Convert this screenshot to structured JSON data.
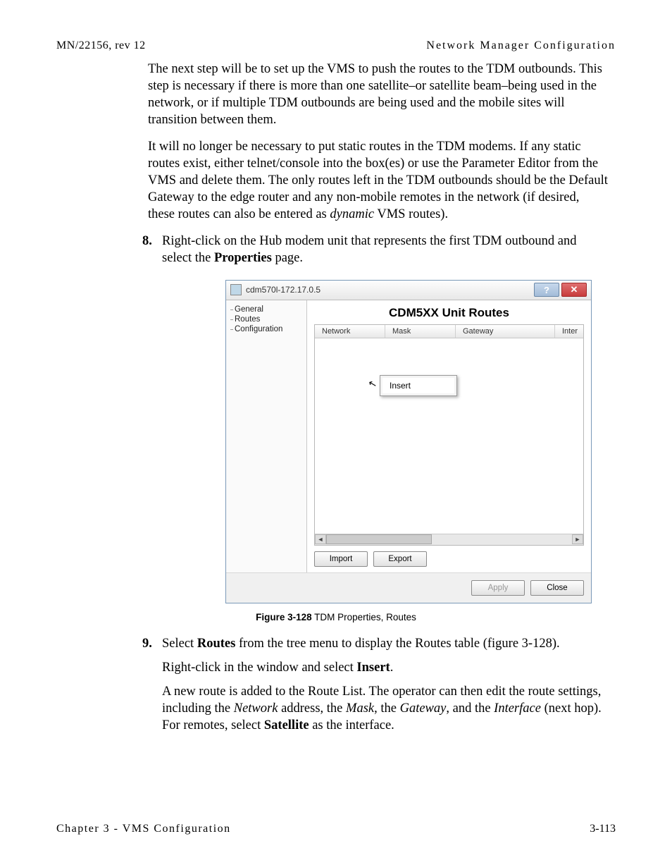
{
  "meta": {
    "doc_id": "MN/22156, rev 12",
    "section_title": "Network Manager Configuration",
    "chapter_footer": "Chapter 3 - VMS Configuration",
    "page_number": "3-113"
  },
  "paragraphs": {
    "p1": "The next step will be to set up the VMS to push the routes to the TDM outbounds. This step is necessary if there is more than one satellite–or satellite beam–being used in the network, or if multiple TDM outbounds are being used and the mobile sites will transition between them.",
    "p2a": "It will no longer be necessary to put static routes in the TDM modems. If any static routes exist, either telnet/console into the box(es) or use the Parameter Editor from the VMS and delete them. The only routes left in the TDM outbounds should be the Default Gateway to the edge router and any non-mobile remotes in the network (if desired, these routes can also be entered as ",
    "p2_dyn": "dynamic",
    "p2b": " VMS routes).",
    "step8_num": " 8.",
    "step8_a": "Right-click on the Hub modem unit that represents the first TDM outbound and select the ",
    "step8_bold": "Properties",
    "step8_b": " page.",
    "step9_num": " 9.",
    "step9_a": "Select ",
    "step9_bold1": "Routes",
    "step9_b": " from the tree menu to display the Routes table (figure 3-128).",
    "step9_p2a": "Right-click in the window and select ",
    "step9_p2_bold": "Insert",
    "step9_p2b": ".",
    "step9_p3a": "A new route is added to the Route List. The operator can then edit the route settings, including the ",
    "step9_p3_net": "Network",
    "step9_p3b": " address, the ",
    "step9_p3_mask": "Mask",
    "step9_p3c": ", the ",
    "step9_p3_gw": "Gateway",
    "step9_p3d": ", and the ",
    "step9_p3_if": "Interface",
    "step9_p3e": " (next hop). For remotes, select ",
    "step9_p3_sat": "Satellite",
    "step9_p3f": " as the interface."
  },
  "dialog": {
    "title": "cdm570l-172.17.0.5",
    "tree": {
      "n1": "General",
      "n2": "Routes",
      "n3": "Configuration"
    },
    "panel_title": "CDM5XX Unit Routes",
    "columns": {
      "network": "Network",
      "mask": "Mask",
      "gateway": "Gateway",
      "inter": "Inter"
    },
    "context_menu": {
      "insert": "Insert"
    },
    "buttons": {
      "import": "Import",
      "export": "Export",
      "apply": "Apply",
      "close": "Close"
    },
    "help_glyph": "?",
    "close_glyph": "✕"
  },
  "caption": {
    "bold": "Figure 3-128",
    "rest": "   TDM Properties, Routes"
  }
}
